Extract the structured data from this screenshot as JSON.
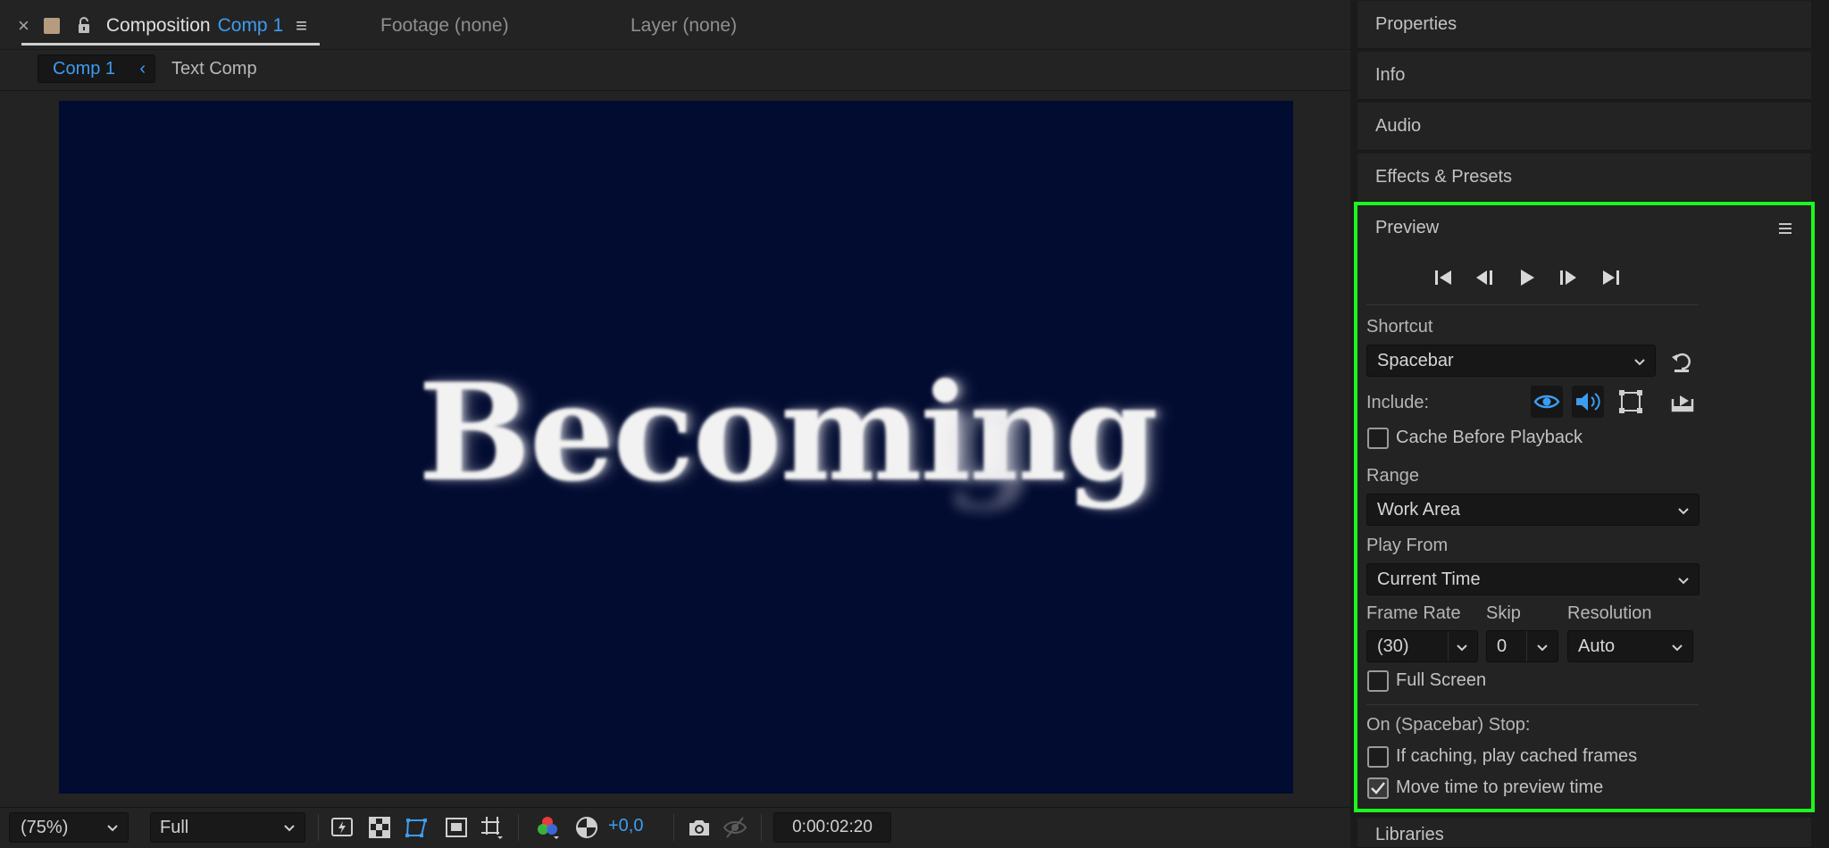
{
  "tabs": {
    "composition_prefix": "Composition",
    "composition_name": "Comp 1",
    "footage": "Footage (none)",
    "layer": "Layer (none)"
  },
  "breadcrumb": {
    "current": "Comp 1",
    "next": "Text Comp"
  },
  "canvas": {
    "text": "Becoming",
    "ghost_glyph": "g",
    "background_color": "#020b30"
  },
  "viewer_controls": {
    "zoom": "(75%)",
    "resolution": "Full",
    "exposure": "+0,0",
    "timecode": "0:00:02:20"
  },
  "panels": {
    "properties": "Properties",
    "info": "Info",
    "audio": "Audio",
    "effects": "Effects & Presets",
    "libraries": "Libraries"
  },
  "preview": {
    "title": "Preview",
    "shortcut_label": "Shortcut",
    "shortcut_value": "Spacebar",
    "include_label": "Include:",
    "cache_before_playback": "Cache Before Playback",
    "range_label": "Range",
    "range_value": "Work Area",
    "play_from_label": "Play From",
    "play_from_value": "Current Time",
    "frame_rate_label": "Frame Rate",
    "frame_rate_value": "(30)",
    "skip_label": "Skip",
    "skip_value": "0",
    "resolution_label": "Resolution",
    "resolution_value": "Auto",
    "full_screen": "Full Screen",
    "on_stop_label": "On (Spacebar) Stop:",
    "if_caching": "If caching, play cached frames",
    "move_time": "Move time to preview time",
    "highlight_color": "#1ff51f",
    "accent_color": "#3d9cf0"
  },
  "checkbox_state": {
    "cache_before_playback": false,
    "full_screen": false,
    "if_caching": false,
    "move_time": true
  }
}
